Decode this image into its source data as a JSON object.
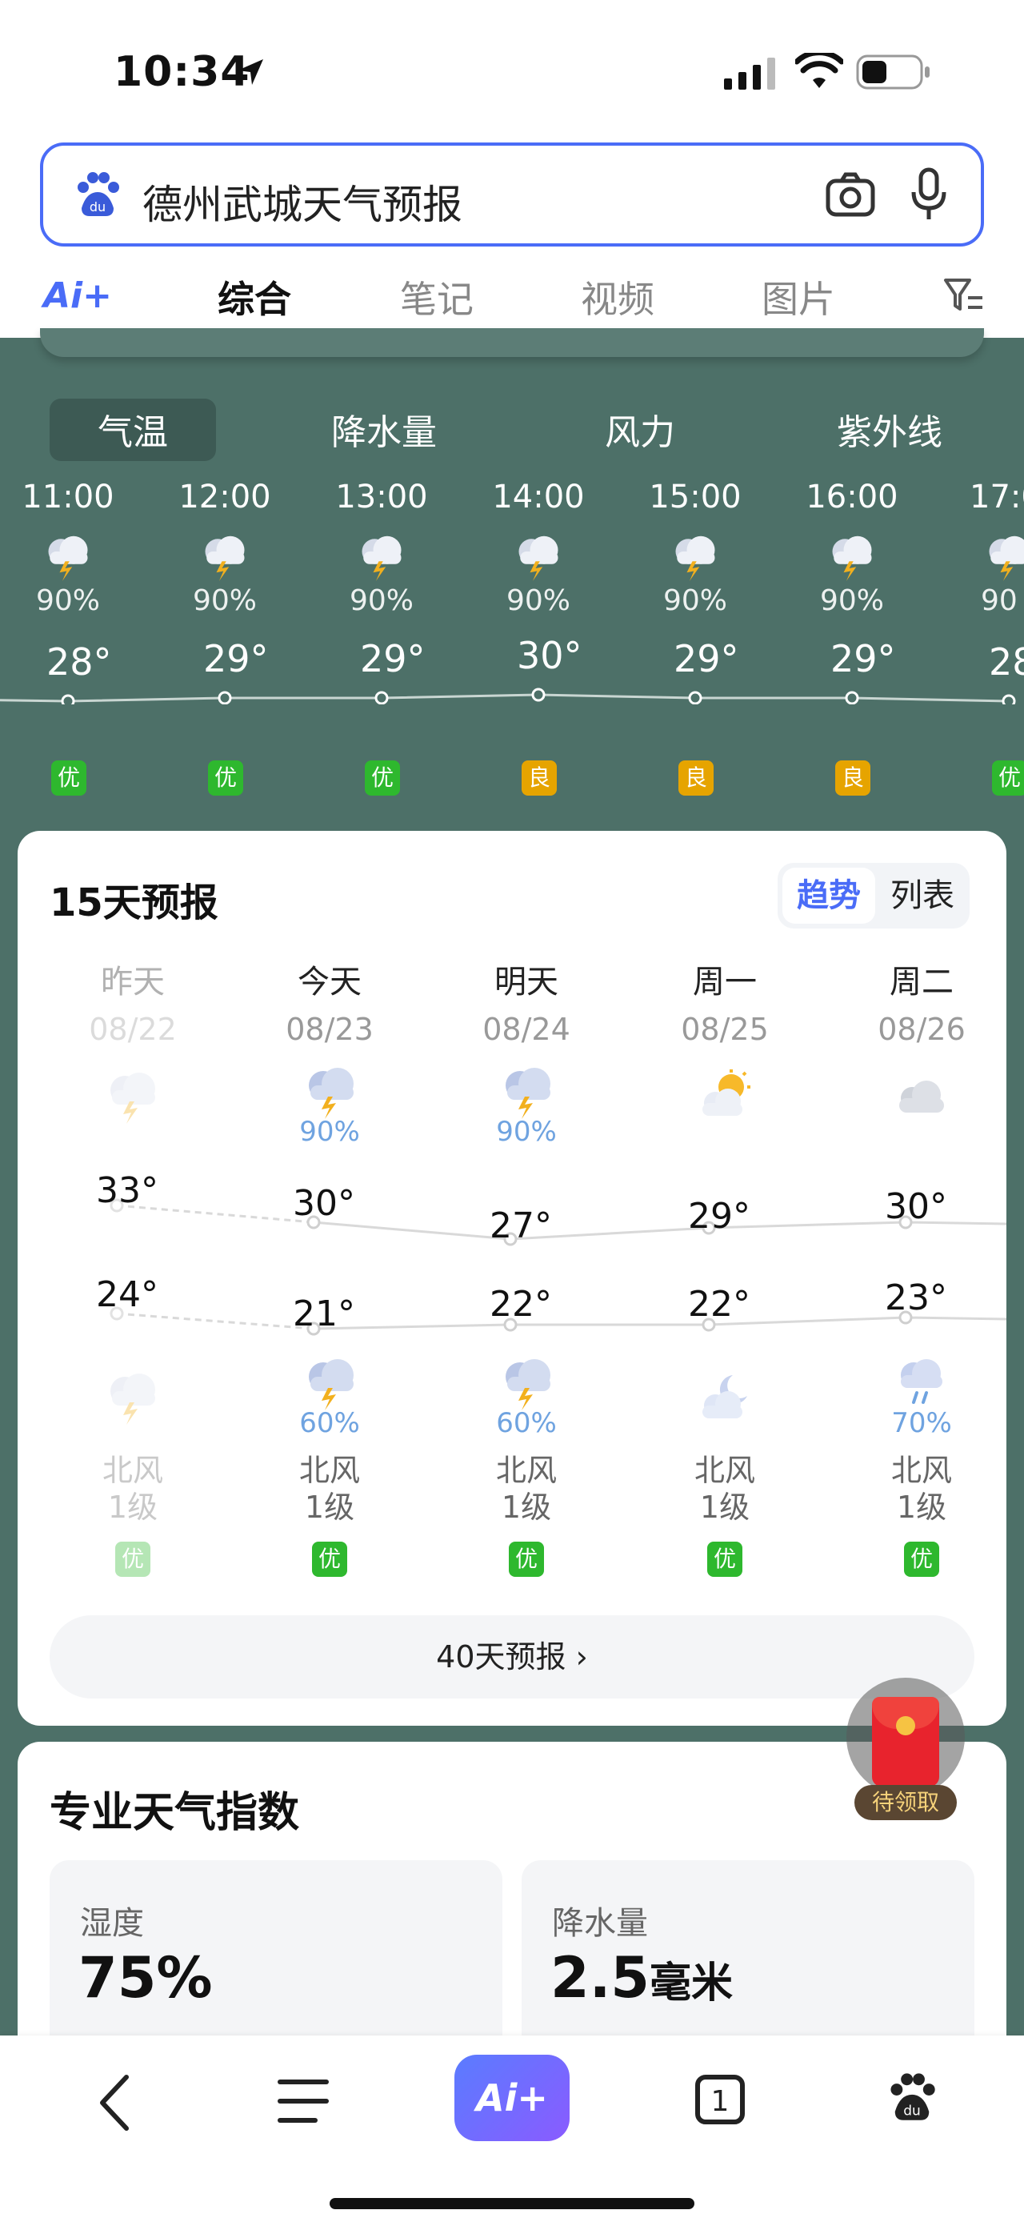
{
  "status_bar": {
    "time": "10:34"
  },
  "search": {
    "query": "德州武城天气预报"
  },
  "tabs": {
    "ai": "Ai+",
    "items": [
      "综合",
      "笔记",
      "视频",
      "图片"
    ]
  },
  "metric_tabs": [
    "气温",
    "降水量",
    "风力",
    "紫外线"
  ],
  "hourly": [
    {
      "time": "11:00",
      "prob": "90%",
      "temp": "28°",
      "aqi": "优",
      "aqi_level": "good"
    },
    {
      "time": "12:00",
      "prob": "90%",
      "temp": "29°",
      "aqi": "优",
      "aqi_level": "good"
    },
    {
      "time": "13:00",
      "prob": "90%",
      "temp": "29°",
      "aqi": "优",
      "aqi_level": "good"
    },
    {
      "time": "14:00",
      "prob": "90%",
      "temp": "30°",
      "aqi": "良",
      "aqi_level": "moderate"
    },
    {
      "time": "15:00",
      "prob": "90%",
      "temp": "29°",
      "aqi": "良",
      "aqi_level": "moderate"
    },
    {
      "time": "16:00",
      "prob": "90%",
      "temp": "29°",
      "aqi": "良",
      "aqi_level": "moderate"
    },
    {
      "time": "17:0",
      "prob": "90",
      "temp": "28",
      "aqi": "优",
      "aqi_level": "good"
    }
  ],
  "forecast15": {
    "title": "15天预报",
    "toggle": {
      "trend": "趋势",
      "list": "列表"
    },
    "days": [
      {
        "name": "昨天",
        "date": "08/22",
        "day_icon": "thunderstorm-icon",
        "day_prob": "",
        "high": "33°",
        "low": "24°",
        "night_icon": "thunderstorm-icon",
        "night_prob": "",
        "wind_dir": "北风",
        "wind_level": "1级",
        "aqi": "优"
      },
      {
        "name": "今天",
        "date": "08/23",
        "day_icon": "thunderstorm-icon",
        "day_prob": "90%",
        "high": "30°",
        "low": "21°",
        "night_icon": "thunderstorm-icon",
        "night_prob": "60%",
        "wind_dir": "北风",
        "wind_level": "1级",
        "aqi": "优"
      },
      {
        "name": "明天",
        "date": "08/24",
        "day_icon": "thunderstorm-icon",
        "day_prob": "90%",
        "high": "27°",
        "low": "22°",
        "night_icon": "thunderstorm-icon",
        "night_prob": "60%",
        "wind_dir": "北风",
        "wind_level": "1级",
        "aqi": "优"
      },
      {
        "name": "周一",
        "date": "08/25",
        "day_icon": "partly-sunny-icon",
        "day_prob": "",
        "high": "29°",
        "low": "22°",
        "night_icon": "moon-cloud-icon",
        "night_prob": "",
        "wind_dir": "北风",
        "wind_level": "1级",
        "aqi": "优"
      },
      {
        "name": "周二",
        "date": "08/26",
        "day_icon": "cloudy-icon",
        "day_prob": "",
        "high": "30°",
        "low": "23°",
        "night_icon": "rain-icon",
        "night_prob": "70%",
        "wind_dir": "北风",
        "wind_level": "1级",
        "aqi": "优"
      }
    ],
    "more": "40天预报 ›"
  },
  "pro_index": {
    "title": "专业天气指数",
    "tiles": [
      {
        "label": "湿度",
        "value": "75%",
        "unit": ""
      },
      {
        "label": "降水量",
        "value": "2.5",
        "unit": "毫米"
      }
    ]
  },
  "red_packet": {
    "label": "待领取"
  },
  "colors": {
    "accent": "#4a6cf7",
    "panel": "#4d7068",
    "aqi_good": "#2eb82e",
    "aqi_moderate": "#e6a400"
  }
}
